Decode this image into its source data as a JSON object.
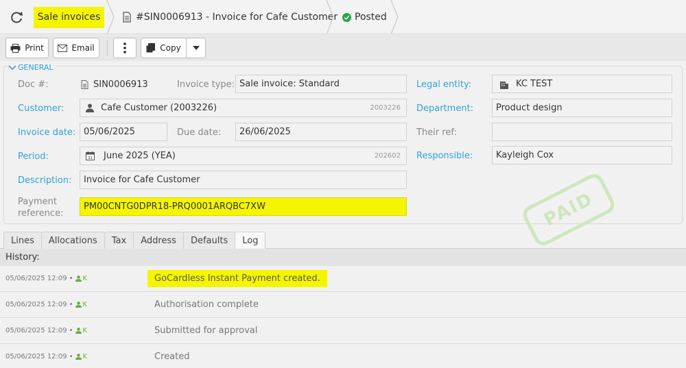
{
  "breadcrumb": {
    "section": "Sale invoices",
    "document": "#SIN0006913 - Invoice for Cafe Customer",
    "status": "Posted"
  },
  "toolbar": {
    "print": "Print",
    "email": "Email",
    "copy": "Copy"
  },
  "general": {
    "legend": "GENERAL",
    "doc_label": "Doc #:",
    "doc_value": "SIN0006913",
    "invoice_type_label": "Invoice type:",
    "invoice_type_value": "Sale invoice: Standard",
    "legal_entity_label": "Legal entity:",
    "legal_entity_value": "KC TEST",
    "customer_label": "Customer:",
    "customer_value": "Cafe Customer (2003226)",
    "customer_code": "2003226",
    "department_label": "Department:",
    "department_value": "Product design",
    "invoice_date_label": "Invoice date:",
    "invoice_date_value": "05/06/2025",
    "due_date_label": "Due date:",
    "due_date_value": "26/06/2025",
    "their_ref_label": "Their ref:",
    "their_ref_value": "",
    "period_label": "Period:",
    "period_value": "June 2025 (YEA)",
    "period_code": "202602",
    "calendar_day": "31",
    "responsible_label": "Responsible:",
    "responsible_value": "Kayleigh Cox",
    "description_label": "Description:",
    "description_value": "Invoice for Cafe Customer",
    "payment_ref_label_1": "Payment",
    "payment_ref_label_2": "reference:",
    "payment_ref_value": "PM00CNTG0DPR18-PRQ0001ARQBC7XW"
  },
  "stamp": "PAID",
  "tabs": [
    {
      "label": "Lines"
    },
    {
      "label": "Allocations"
    },
    {
      "label": "Tax"
    },
    {
      "label": "Address"
    },
    {
      "label": "Defaults"
    },
    {
      "label": "Log",
      "active": true
    }
  ],
  "history": {
    "title": "History:",
    "entries": [
      {
        "time": "05/06/2025 12:09",
        "user": "K",
        "message": "GoCardless Instant Payment created."
      },
      {
        "time": "05/06/2025 12:09",
        "user": "K",
        "message": "Authorisation complete"
      },
      {
        "time": "05/06/2025 12:09",
        "user": "K",
        "message": "Submitted for approval"
      },
      {
        "time": "05/06/2025 12:09",
        "user": "K",
        "message": "Created"
      }
    ]
  },
  "colors": {
    "highlight": "#f5f500",
    "link_label": "#2ea3d6",
    "user_green": "#69ab3e",
    "status_green": "#27a745",
    "stamp": "#cde7bd"
  }
}
